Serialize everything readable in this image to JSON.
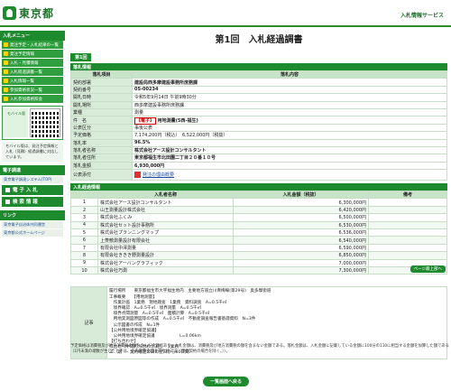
{
  "header": {
    "logo_text": "東京都",
    "right_title": "入札情報サービス"
  },
  "sidebar": {
    "section1": "入札メニュー",
    "items": [
      "発注予定・入札結果の一覧",
      "発注予定情報",
      "入札・見積情報",
      "入札経過調書一覧",
      "入札情報一覧",
      "参加資格状況一覧",
      "入札参加資格照会"
    ],
    "mobile_label": "モバイル版",
    "note": "モバイル版は、発注予定情報と入札（見積）経過調書に対応しています。",
    "section2": "電子調達",
    "links": [
      "東京電子調達システム(TOP)"
    ],
    "buttons": [
      "電 子 入 札",
      "検 索 情 報"
    ],
    "section3": "リンク",
    "extra_links": [
      "東京電子自治体共同運営",
      "東京都公式ホームページ"
    ]
  },
  "page": {
    "title": "第1回　入札経過調書",
    "tab_label": "第1回",
    "bid_info_header": "落札情報",
    "col_item": "落札項目",
    "col_content": "落札内容",
    "rows": [
      {
        "label": "契約部署",
        "value": "建設局西多摩建設事務所庶務課"
      },
      {
        "label": "契約番号",
        "value": "05-00234"
      },
      {
        "label": "開札日時",
        "value": "令和5年9月14日 午前9時30分"
      },
      {
        "label": "開札場所",
        "value": "西多摩建設事務所庶務課"
      },
      {
        "label": "業種",
        "value": "測量"
      },
      {
        "label": "件　名",
        "value": "用地測量(5西-福生)",
        "kind": "【電子】"
      },
      {
        "label": "公表区分",
        "value": "事後公表"
      },
      {
        "label": "予定価格",
        "value": "7,174,200円（税込）　6,522,000円（税抜）"
      },
      {
        "label": "落札率",
        "value": "96.5%"
      },
      {
        "label": "落札者名称",
        "value": "株式会社アース設計コンサルタント"
      },
      {
        "label": "落札者住所",
        "value": "東京都福生市北田園二丁目２０番１０号"
      },
      {
        "label": "落札金額",
        "value": "6,930,000円"
      },
      {
        "label": "公表添付",
        "value": "発注の理由概要"
      }
    ],
    "history_header": "入札経過情報",
    "history_cols": [
      "",
      "入札者名称",
      "入札金額（税抜）",
      "備考"
    ],
    "bidders": [
      {
        "no": "1",
        "name": "株式会社アース設計コンサルタント",
        "amount": "6,300,000円"
      },
      {
        "no": "2",
        "name": "山王測量設計株式会社",
        "amount": "6,420,000円"
      },
      {
        "no": "3",
        "name": "株式会社ふくみ",
        "amount": "6,500,000円"
      },
      {
        "no": "4",
        "name": "株式会社セット設計事務所",
        "amount": "6,530,000円"
      },
      {
        "no": "5",
        "name": "株式会社プランニングマップ",
        "amount": "6,536,000円"
      },
      {
        "no": "6",
        "name": "上菱敷測量設計有限会社",
        "amount": "6,540,000円"
      },
      {
        "no": "7",
        "name": "有限会社中澤測量",
        "amount": "6,590,000円"
      },
      {
        "no": "8",
        "name": "有限会社ききき野測量設計",
        "amount": "6,850,000円"
      },
      {
        "no": "9",
        "name": "株式会社アーバングラフィック",
        "amount": "7,000,000円"
      },
      {
        "no": "10",
        "name": "株式会社巧測",
        "amount": "7,300,000円"
      }
    ],
    "history_button": "ページ最上部へ",
    "remark_label": "記事",
    "remark_text": "履行場所　　東京都福生市大字福生地内　主要地方道立川青梅線(第29号)　奥多摩街道\n工事概要　　【用地測量】\n　作業計画　1業務　現地踏査　1業務　資料調査　A=0.5千㎡\n　境界確認　A=0.5千㎡　境界測量　A=0.5千㎡\n　境界点間測量　A=0.5千㎡　面積計算　A=0.5千㎡\n　用地実測図原図等の作成　A=0.5千㎡　不動産調査報告書基礎資料　N=3件\n　公示図書の作成　N=1件\n【公共用地境界確定協議】\n　公共用地境界確定協議　　　　　　L=0.06km\n【打ち合わせ】\n打合せ（中間打ち合わせ3回）　1業務\n工　期　　契約確定の日の翌日から60日間",
    "footer_note": "予定価格は消費税及び地方消費税の額を含んだ金額であり、入札金額は、消費税及び地方消費税の額を含まない金額である。落札金額は、入札金額に記載している金額に100分の110に相当する金額を加算した額である（1円未満の端数が生じたときは、その端数金額を切り捨てる（単価契約の場合を除く。））。",
    "back_button": "一覧画面へ戻る"
  },
  "colors": {
    "brand_green": "#1e8a2e",
    "header_green": "#d8ead8"
  }
}
